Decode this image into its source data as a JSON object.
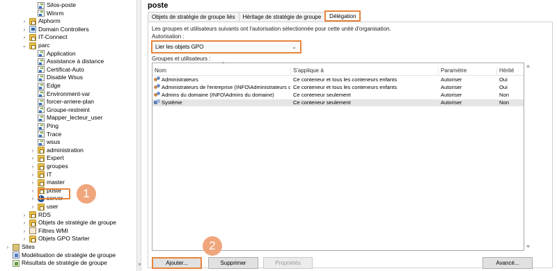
{
  "tree": {
    "items": [
      {
        "label": "Silos-poste",
        "icon": "gpo-link-icon",
        "indent": 3,
        "expander": ""
      },
      {
        "label": "Winrm",
        "icon": "gpo-link-icon",
        "indent": 3,
        "expander": ""
      },
      {
        "label": "Alphorm",
        "icon": "ou-folder-icon",
        "indent": 2,
        "expander": "›"
      },
      {
        "label": "Domain Controllers",
        "icon": "domain-controller-icon",
        "indent": 2,
        "expander": "›"
      },
      {
        "label": "IT-Connect",
        "icon": "ou-folder-icon",
        "indent": 2,
        "expander": "›"
      },
      {
        "label": "parc",
        "icon": "ou-folder-icon",
        "indent": 2,
        "expander": "⌄"
      },
      {
        "label": "Application",
        "icon": "gpo-link-icon",
        "indent": 3,
        "expander": ""
      },
      {
        "label": "Assistance à distance",
        "icon": "gpo-link-icon",
        "indent": 3,
        "expander": ""
      },
      {
        "label": "Certificat-Auto",
        "icon": "gpo-link-icon",
        "indent": 3,
        "expander": ""
      },
      {
        "label": "Disable Wsus",
        "icon": "gpo-link-icon",
        "indent": 3,
        "expander": ""
      },
      {
        "label": "Edge",
        "icon": "gpo-link-icon",
        "indent": 3,
        "expander": ""
      },
      {
        "label": "Environment-var",
        "icon": "gpo-link-icon",
        "indent": 3,
        "expander": ""
      },
      {
        "label": "forcer-arriere-plan",
        "icon": "gpo-link-icon",
        "indent": 3,
        "expander": ""
      },
      {
        "label": "Groupe-restreint",
        "icon": "gpo-link-icon",
        "indent": 3,
        "expander": ""
      },
      {
        "label": "Mapper_lecteur_user",
        "icon": "gpo-link-icon",
        "indent": 3,
        "expander": ""
      },
      {
        "label": "Ping",
        "icon": "gpo-link-icon",
        "indent": 3,
        "expander": ""
      },
      {
        "label": "Trace",
        "icon": "gpo-link-icon",
        "indent": 3,
        "expander": ""
      },
      {
        "label": "wsus",
        "icon": "gpo-link-icon",
        "indent": 3,
        "expander": ""
      },
      {
        "label": "administration",
        "icon": "ou-folder-icon",
        "indent": 3,
        "expander": "›"
      },
      {
        "label": "Expert",
        "icon": "ou-folder-icon",
        "indent": 3,
        "expander": "›"
      },
      {
        "label": "groupes",
        "icon": "ou-folder-icon",
        "indent": 3,
        "expander": "›"
      },
      {
        "label": "IT",
        "icon": "ou-folder-icon",
        "indent": 3,
        "expander": "›"
      },
      {
        "label": "master",
        "icon": "ou-folder-icon",
        "indent": 3,
        "expander": "›"
      },
      {
        "label": "poste",
        "icon": "ou-folder-icon",
        "indent": 3,
        "expander": "›"
      },
      {
        "label": "server",
        "icon": "server-ou-icon",
        "indent": 3,
        "expander": "›"
      },
      {
        "label": "user",
        "icon": "ou-folder-icon",
        "indent": 3,
        "expander": "›"
      },
      {
        "label": "RDS",
        "icon": "ou-folder-icon",
        "indent": 2,
        "expander": "›"
      },
      {
        "label": "Objets de stratégie de groupe",
        "icon": "gpo-container-icon",
        "indent": 2,
        "expander": "›"
      },
      {
        "label": "Filtres WMI",
        "icon": "wmi-filter-icon",
        "indent": 2,
        "expander": "›"
      },
      {
        "label": "Objets GPO Starter",
        "icon": "starter-gpo-icon",
        "indent": 2,
        "expander": "›"
      },
      {
        "label": "Sites",
        "icon": "sites-icon",
        "indent": 0,
        "expander": "›"
      },
      {
        "label": "Modélisation de stratégie de groupe",
        "icon": "modeling-icon",
        "indent": 0,
        "expander": ""
      },
      {
        "label": "Résultats de stratégie de groupe",
        "icon": "results-icon",
        "indent": 0,
        "expander": ""
      }
    ]
  },
  "annotations": {
    "step1": "1",
    "step2": "2",
    "highlight_color": "#e6843c"
  },
  "pane": {
    "title": "poste",
    "tabs": [
      {
        "label": "Objets de stratégie de groupe liés",
        "active": false
      },
      {
        "label": "Héritage de stratégie de groupe",
        "active": false
      },
      {
        "label": "Délégation",
        "active": true
      }
    ],
    "info_text": "Les groupes et utilisateurs suivants ont l'autorisation sélectionnée pour cette unité d'organisation.",
    "autorisation_label": "Autorisation :",
    "autorisation_value": "Lier les objets GPO",
    "groups_label": "Groupes et utilisateurs :",
    "columns": [
      "Nom",
      "S'applique à",
      "Paramètre",
      "Hérité"
    ],
    "rows": [
      {
        "name": "Administrateurs",
        "applies": "Ce conteneur et tous les conteneurs enfants",
        "setting": "Autoriser",
        "inherited": "Oui",
        "icon": "user-group-icon",
        "selected": false
      },
      {
        "name": "Administrateurs de l'entreprise (INFO\\Administrateurs de l'...",
        "applies": "Ce conteneur et tous les conteneurs enfants",
        "setting": "Autoriser",
        "inherited": "Oui",
        "icon": "user-group-icon",
        "selected": false
      },
      {
        "name": "Admins du domaine (INFO\\Admins du domaine)",
        "applies": "Ce conteneur seulement",
        "setting": "Autoriser",
        "inherited": "Non",
        "icon": "user-group-icon",
        "selected": false
      },
      {
        "name": "Système",
        "applies": "Ce conteneur seulement",
        "setting": "Autoriser",
        "inherited": "Non",
        "icon": "system-icon",
        "selected": true
      }
    ],
    "buttons": {
      "add": "Ajouter...",
      "remove": "Supprimer",
      "properties": "Propriétés",
      "advanced": "Avancé..."
    }
  }
}
